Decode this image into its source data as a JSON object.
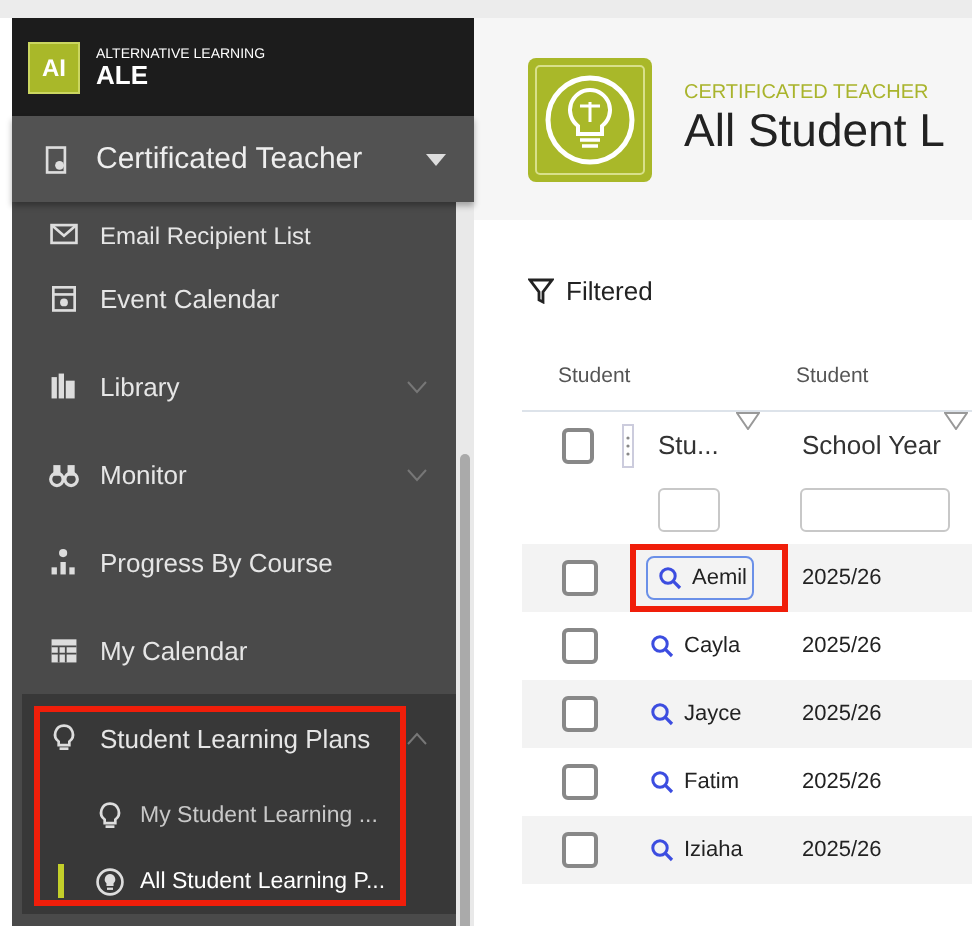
{
  "app": {
    "logo": "AI",
    "subtitle": "ALTERNATIVE LEARNING",
    "name": "ALE"
  },
  "role_menu": {
    "label": "Certificated Teacher",
    "expanded": false
  },
  "sidebar": {
    "items": [
      {
        "label": "Email Recipient List",
        "kind": "link",
        "highlighted": false
      },
      {
        "label": "Event Calendar",
        "kind": "link",
        "highlighted": false
      },
      {
        "label": "Library",
        "kind": "menu",
        "expanded": false,
        "highlighted": false
      },
      {
        "label": "Monitor",
        "kind": "menu",
        "expanded": false,
        "highlighted": false
      },
      {
        "label": "Progress By Course",
        "kind": "link",
        "highlighted": false
      },
      {
        "label": "My Calendar",
        "kind": "link",
        "highlighted": false
      },
      {
        "label": "Student Learning Plans",
        "kind": "menu",
        "expanded": true,
        "highlighted": true,
        "children": [
          {
            "label": "My Student Learning ...",
            "selected": false
          },
          {
            "label": "All Student Learning P...",
            "selected": true
          }
        ]
      }
    ]
  },
  "page": {
    "section": "CERTIFICATED TEACHER",
    "title": "All Student L"
  },
  "filter_label": "Filtered",
  "table": {
    "groups": [
      "Student",
      "Student"
    ],
    "columns": [
      "Stu...",
      "School Year"
    ],
    "select_all_checked": false,
    "rows": [
      {
        "checked": false,
        "student": "Aemil",
        "year": "2025/26",
        "highlighted": true
      },
      {
        "checked": false,
        "student": "Cayla",
        "year": "2025/26",
        "highlighted": false
      },
      {
        "checked": false,
        "student": "Jayce",
        "year": "2025/26",
        "highlighted": false
      },
      {
        "checked": false,
        "student": "Fatim",
        "year": "2025/26",
        "highlighted": false
      },
      {
        "checked": false,
        "student": "Iziaha",
        "year": "2025/26",
        "highlighted": false
      }
    ]
  }
}
